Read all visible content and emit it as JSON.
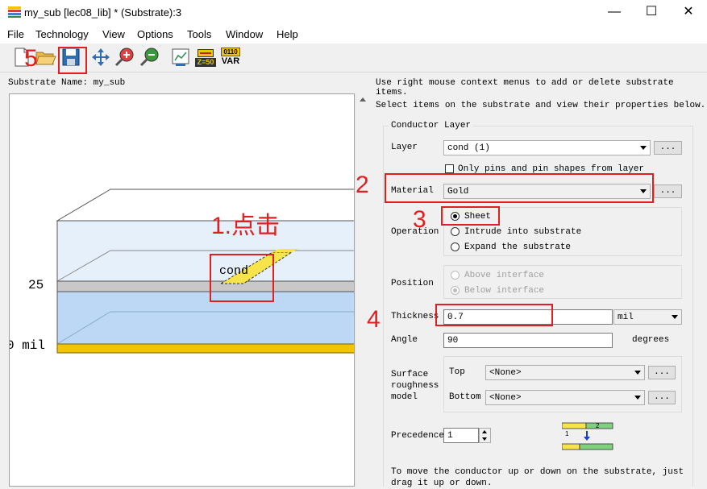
{
  "window": {
    "title": "my_sub [lec08_lib] * (Substrate):3",
    "minimize": "—",
    "maximize": "☐",
    "close": "✕"
  },
  "menu": [
    "File",
    "Technology",
    "View",
    "Options",
    "Tools",
    "Window",
    "Help"
  ],
  "toolbar": {
    "z50_label": "Z=50",
    "var_bits": "0110",
    "var_label": "VAR"
  },
  "substrate": {
    "name_label": "Substrate Name:",
    "name_value": "my_sub"
  },
  "canvas": {
    "tick_25": "25",
    "tick_0": "0 mil",
    "cond_label": "cond"
  },
  "panel": {
    "hint1": "Use right mouse context menus to add or delete substrate items.",
    "hint2": "Select items on the substrate and view their properties below.",
    "group_title": "Conductor Layer",
    "layer_label": "Layer",
    "layer_value": "cond (1)",
    "only_pins_label": "Only pins and pin shapes from layer",
    "material_label": "Material",
    "material_value": "Gold",
    "operation_label": "Operation",
    "op_sheet": "Sheet",
    "op_intrude": "Intrude into substrate",
    "op_expand": "Expand the substrate",
    "position_label": "Position",
    "pos_above": "Above interface",
    "pos_below": "Below interface",
    "thickness_label": "Thickness",
    "thickness_value": "0.7",
    "thickness_unit": "mil",
    "angle_label": "Angle",
    "angle_value": "90",
    "angle_unit": "degrees",
    "roughness_label": "Surface roughness model",
    "top_label": "Top",
    "top_value": "<None>",
    "bottom_label": "Bottom",
    "bottom_value": "<None>",
    "precedence_label": "Precedence",
    "precedence_value": "1",
    "footer": "To move the conductor up or down on the substrate, just drag it up or down.",
    "dots": "..."
  },
  "annotations": {
    "a1": "1.点击",
    "a2": "2",
    "a3": "3",
    "a4": "4",
    "a5": "5"
  },
  "colors": {
    "annotation_red": "#e02020",
    "gold": "#f2c500",
    "substrate_blue": "#bcd8f5"
  }
}
